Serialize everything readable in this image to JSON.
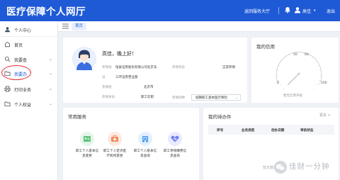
{
  "header": {
    "title": "医疗保障个人网厅",
    "return_hall": "返回服务大厅",
    "user_name": "高佳",
    "logout": "退出",
    "bell_icon": "bell-icon",
    "user_icon": "user-icon"
  },
  "sidebar": {
    "items": [
      {
        "label": "个人中心",
        "icon": "user-circle-icon"
      },
      {
        "label": "首页",
        "icon": "home-icon"
      },
      {
        "label": "我要查",
        "icon": "search-icon"
      },
      {
        "label": "我要办",
        "icon": "folder-icon"
      },
      {
        "label": "打印业务",
        "icon": "print-icon"
      },
      {
        "label": "个人权益",
        "icon": "folder-icon"
      }
    ],
    "highlight_color": "#e8262a"
  },
  "tabbar": {
    "home_tab": "首页",
    "menu_icon": "menu-icon"
  },
  "profile": {
    "greeting": "高佳，晚上好！",
    "rows": [
      {
        "label": "参保地",
        "value": "恒泰证券股份有限公司北京东",
        "label2": "参保状态",
        "value2": "正常参保"
      },
      {
        "label": "证",
        "value": "三环证券营业部",
        "label2": "",
        "value2": ""
      },
      {
        "label": "参保地",
        "value": "北京市",
        "label2": "参保险种",
        "value2": "城镇职工基本医疗保险"
      },
      {
        "label": "参保身份",
        "value": "职工在职",
        "label2": "",
        "value2": ""
      }
    ]
  },
  "credit": {
    "title": "我的信用",
    "gauge_min": "0",
    "gauge_max": "100",
    "gauge_mid_left": "50",
    "gauge_mid_right": "60",
    "caption": "暂无信用评级",
    "value": 0
  },
  "services": {
    "title": "常用服务",
    "items": [
      {
        "label_line1": "职工个人基本信",
        "label_line2": "息变更",
        "icon": "id-card-icon",
        "color": "#5cc278"
      },
      {
        "label_line1": "职工个人定点医",
        "label_line2": "疗机构变更",
        "icon": "medical-kit-icon",
        "color": "#f08a5d"
      },
      {
        "label_line1": "职工个人基本信",
        "label_line2": "息查询",
        "icon": "building-icon",
        "color": "#4a9df0"
      },
      {
        "label_line1": "职工参保缴费信",
        "label_line2": "息查询",
        "icon": "heart-icon",
        "color": "#6c7ff0"
      }
    ]
  },
  "todo": {
    "title": "我的待办件",
    "more": "更多 >",
    "columns": [
      "序号",
      "业务类型",
      "创办日期",
      "审核状态"
    ]
  },
  "watermark": {
    "text": "佳财一分钟",
    "small": "暂无数据",
    "logo": "wechat-logo"
  }
}
